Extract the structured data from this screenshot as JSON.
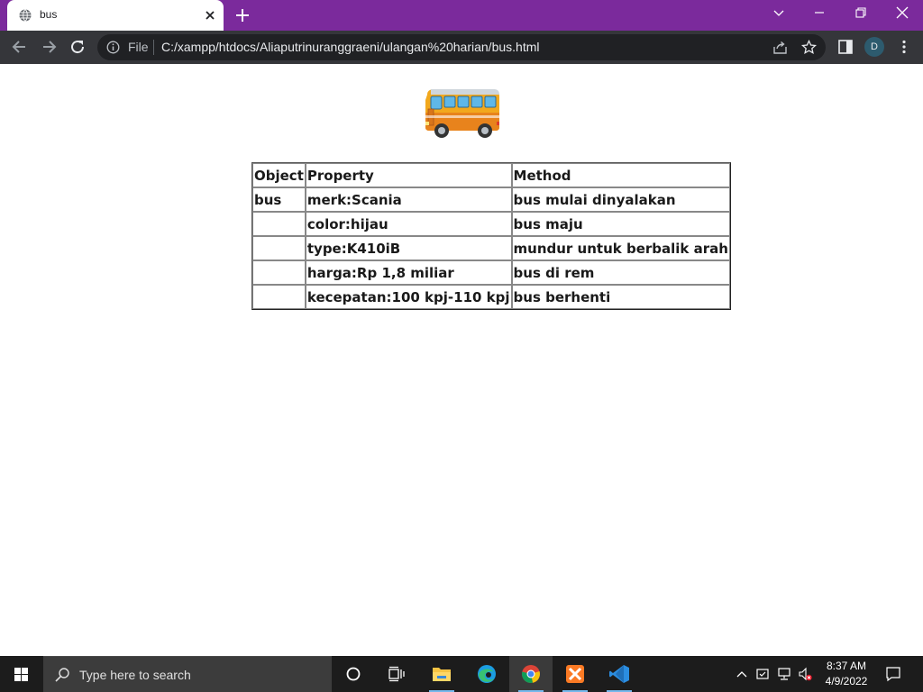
{
  "browser": {
    "tab_title": "bus",
    "address_prefix": "File",
    "url": "C:/xampp/htdocs/Aliaputrinuranggraeni/ulangan%20harian/bus.html",
    "profile_initial": "D"
  },
  "page": {
    "image_icon": "bus-emoji",
    "table": {
      "headers": [
        "Object",
        "Property",
        "Method"
      ],
      "rows": [
        [
          "bus",
          "merk:Scania",
          "bus mulai dinyalakan"
        ],
        [
          "",
          "color:hijau",
          "bus maju"
        ],
        [
          "",
          "type:K410iB",
          "mundur untuk berbalik arah"
        ],
        [
          "",
          "harga:Rp 1,8 miliar",
          "bus di rem"
        ],
        [
          "",
          "kecepatan:100 kpj-110 kpj",
          "bus berhenti"
        ]
      ]
    }
  },
  "taskbar": {
    "search_placeholder": "Type here to search",
    "time": "8:37 AM",
    "date": "4/9/2022",
    "apps": [
      "task-view",
      "file-explorer",
      "edge",
      "chrome",
      "xampp",
      "vscode"
    ]
  },
  "colors": {
    "tabstrip": "#7b2a9c",
    "toolbar": "#35363a",
    "omnibox": "#202124",
    "taskbar": "#1c1c1c"
  }
}
